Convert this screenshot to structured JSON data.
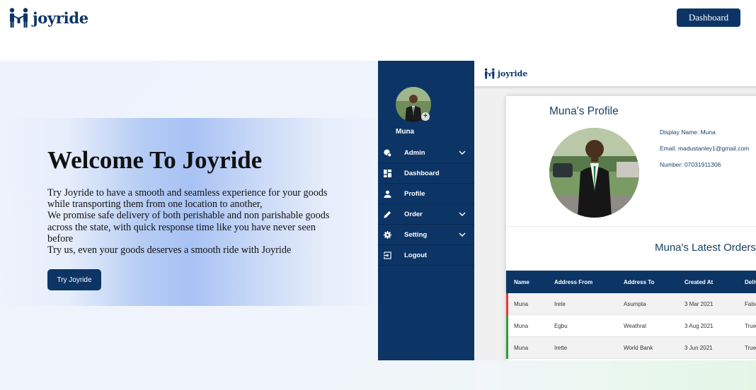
{
  "nav": {
    "brand": "joyride",
    "dashboard_button": "Dashboard"
  },
  "hero": {
    "title": "Welcome To Joyride",
    "paragraph_lines": [
      "Try Joyride to have a smooth and seamless experience for your goods while transporting them from one location to another,",
      "We promise safe delivery of both perishable and non parishable goods across the state, with quick response time like you have never seen before",
      "Try us, even your goods deserves a smooth ride with Joyride"
    ],
    "cta_button": "Try Joyride"
  },
  "preview": {
    "header_brand": "joyride",
    "sidebar": {
      "user_name": "Muna",
      "items": [
        {
          "label": "Admin",
          "icon": "admin-icon",
          "has_dropdown": true
        },
        {
          "label": "Dashboard",
          "icon": "dashboard-icon",
          "has_dropdown": false
        },
        {
          "label": "Profile",
          "icon": "person-icon",
          "has_dropdown": false
        },
        {
          "label": "Order",
          "icon": "pencil-icon",
          "has_dropdown": true
        },
        {
          "label": "Setting",
          "icon": "gear-icon",
          "has_dropdown": true
        },
        {
          "label": "Logout",
          "icon": "logout-icon",
          "has_dropdown": false
        }
      ]
    },
    "profile": {
      "title": "Muna's Profile",
      "display_name": "Display Name: Muna",
      "email": "Email: madustanley1@gmail.com",
      "number": "Number: 07031911306"
    },
    "orders": {
      "title": "Muna's Latest Orders",
      "columns": [
        "Name",
        "Address From",
        "Address To",
        "Created At",
        "Delivered"
      ],
      "rows": [
        {
          "cells": [
            "Muna",
            "Irete",
            "Asumpta",
            "3 Mar 2021",
            "False"
          ],
          "status_color": "#e53935"
        },
        {
          "cells": [
            "Muna",
            "Egbu",
            "Weathral",
            "3 Aug 2021",
            "True"
          ],
          "status_color": "#2e9b3a"
        },
        {
          "cells": [
            "Muna",
            "Irette",
            "World Bank",
            "3 Jun 2021",
            "True"
          ],
          "status_color": "#2e9b3a"
        }
      ]
    }
  },
  "colors": {
    "brand_navy": "#0c3566",
    "hero_band": "#a8c2f4",
    "status_false": "#e53935",
    "status_true": "#2e9b3a"
  }
}
